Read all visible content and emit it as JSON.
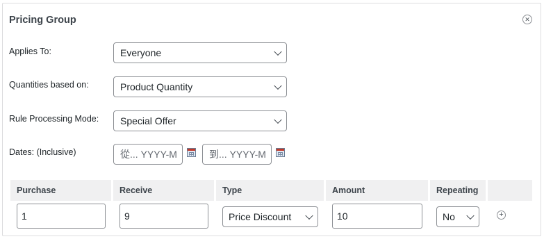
{
  "panel": {
    "title": "Pricing Group",
    "close_icon": "close-circle-icon"
  },
  "form": {
    "applies_to": {
      "label": "Applies To:",
      "value": "Everyone"
    },
    "quantities_based_on": {
      "label": "Quantities based on:",
      "value": "Product Quantity"
    },
    "rule_processing_mode": {
      "label": "Rule Processing Mode:",
      "value": "Special Offer"
    },
    "dates": {
      "label": "Dates: (Inclusive)",
      "from_placeholder": "從... YYYY-M",
      "to_placeholder": "到... YYYY-M",
      "calendar_icon": "calendar-icon"
    }
  },
  "table": {
    "headers": [
      "Purchase",
      "Receive",
      "Type",
      "Amount",
      "Repeating"
    ],
    "row": {
      "purchase": "1",
      "receive": "9",
      "type": "Price Discount",
      "amount": "10",
      "repeating": "No"
    },
    "add_icon": "plus-circle-icon"
  }
}
